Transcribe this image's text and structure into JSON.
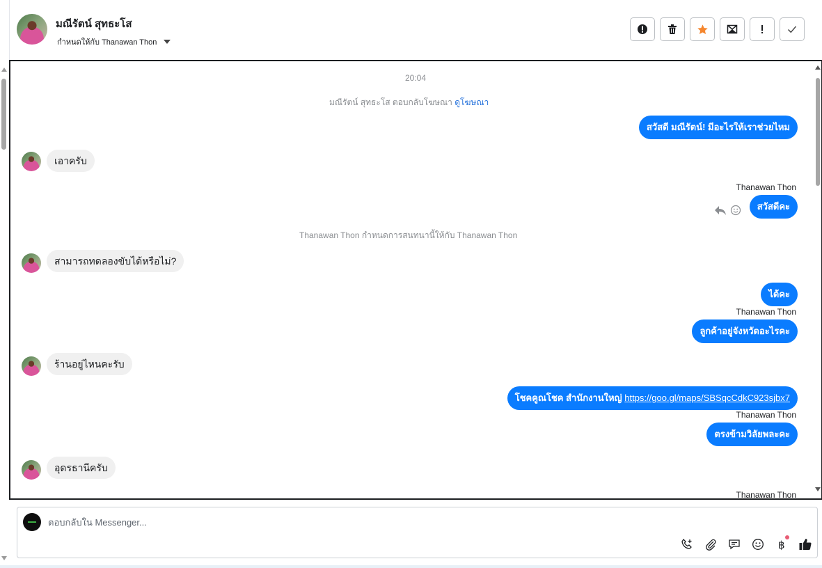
{
  "header": {
    "contact_name": "มณีรัตน์ สุทธะโส",
    "assign_label": "กำหนดให้กับ Thanawan Thon",
    "actions": [
      {
        "name": "mark-spam-button",
        "icon": "exclamation-circle-icon"
      },
      {
        "name": "delete-button",
        "icon": "trash-icon"
      },
      {
        "name": "star-button",
        "icon": "star-icon",
        "color": "#f5862e"
      },
      {
        "name": "mark-unread-button",
        "icon": "envelope-icon"
      },
      {
        "name": "priority-button",
        "icon": "exclamation-icon"
      },
      {
        "name": "mark-done-button",
        "icon": "check-icon"
      }
    ]
  },
  "conversation": {
    "timestamp": "20:04",
    "ad_reply_notice": "มณีรัตน์ สุทธะโส ตอบกลับโฆษณา",
    "view_ad_link": "ดูโฆษณา",
    "messages": {
      "m1": "สวัสดี มณีรัตน์! มีอะไรให้เราช่วยไหม",
      "m2": "เอาครับ",
      "m3_sender": "Thanawan Thon",
      "m3": "สวัสดีคะ",
      "assign_notice": "Thanawan Thon กำหนดการสนทนานี้ให้กับ Thanawan Thon",
      "m4": "สามารถทดลองขับได้หรือไม่?",
      "m5": "ได้คะ",
      "m6_sender": "Thanawan Thon",
      "m6": "ลูกค้าอยู่จังหวัดอะไรคะ",
      "m7": "ร้านอยู่ไหนคะรับ",
      "m8_text": "โชคคูณโชค สำนักงานใหญ่ ",
      "m8_link": "https://goo.gl/maps/SBSqcCdkC923sjbx7",
      "m9_sender": "Thanawan Thon",
      "m9": "ตรงข้ามวิลัยพละคะ",
      "m10": "อุดรธานีครับ",
      "m11_sender": "Thanawan Thon"
    }
  },
  "composer": {
    "placeholder": "ตอบกลับใน Messenger...",
    "tools": [
      "phone-plus-icon",
      "paperclip-icon",
      "saved-reply-icon",
      "emoji-icon",
      "baht-icon",
      "thumbs-up-icon"
    ]
  },
  "colors": {
    "outgoing_bubble": "#0a7cff",
    "incoming_bubble": "#f0f0f0",
    "star": "#f5862e"
  }
}
